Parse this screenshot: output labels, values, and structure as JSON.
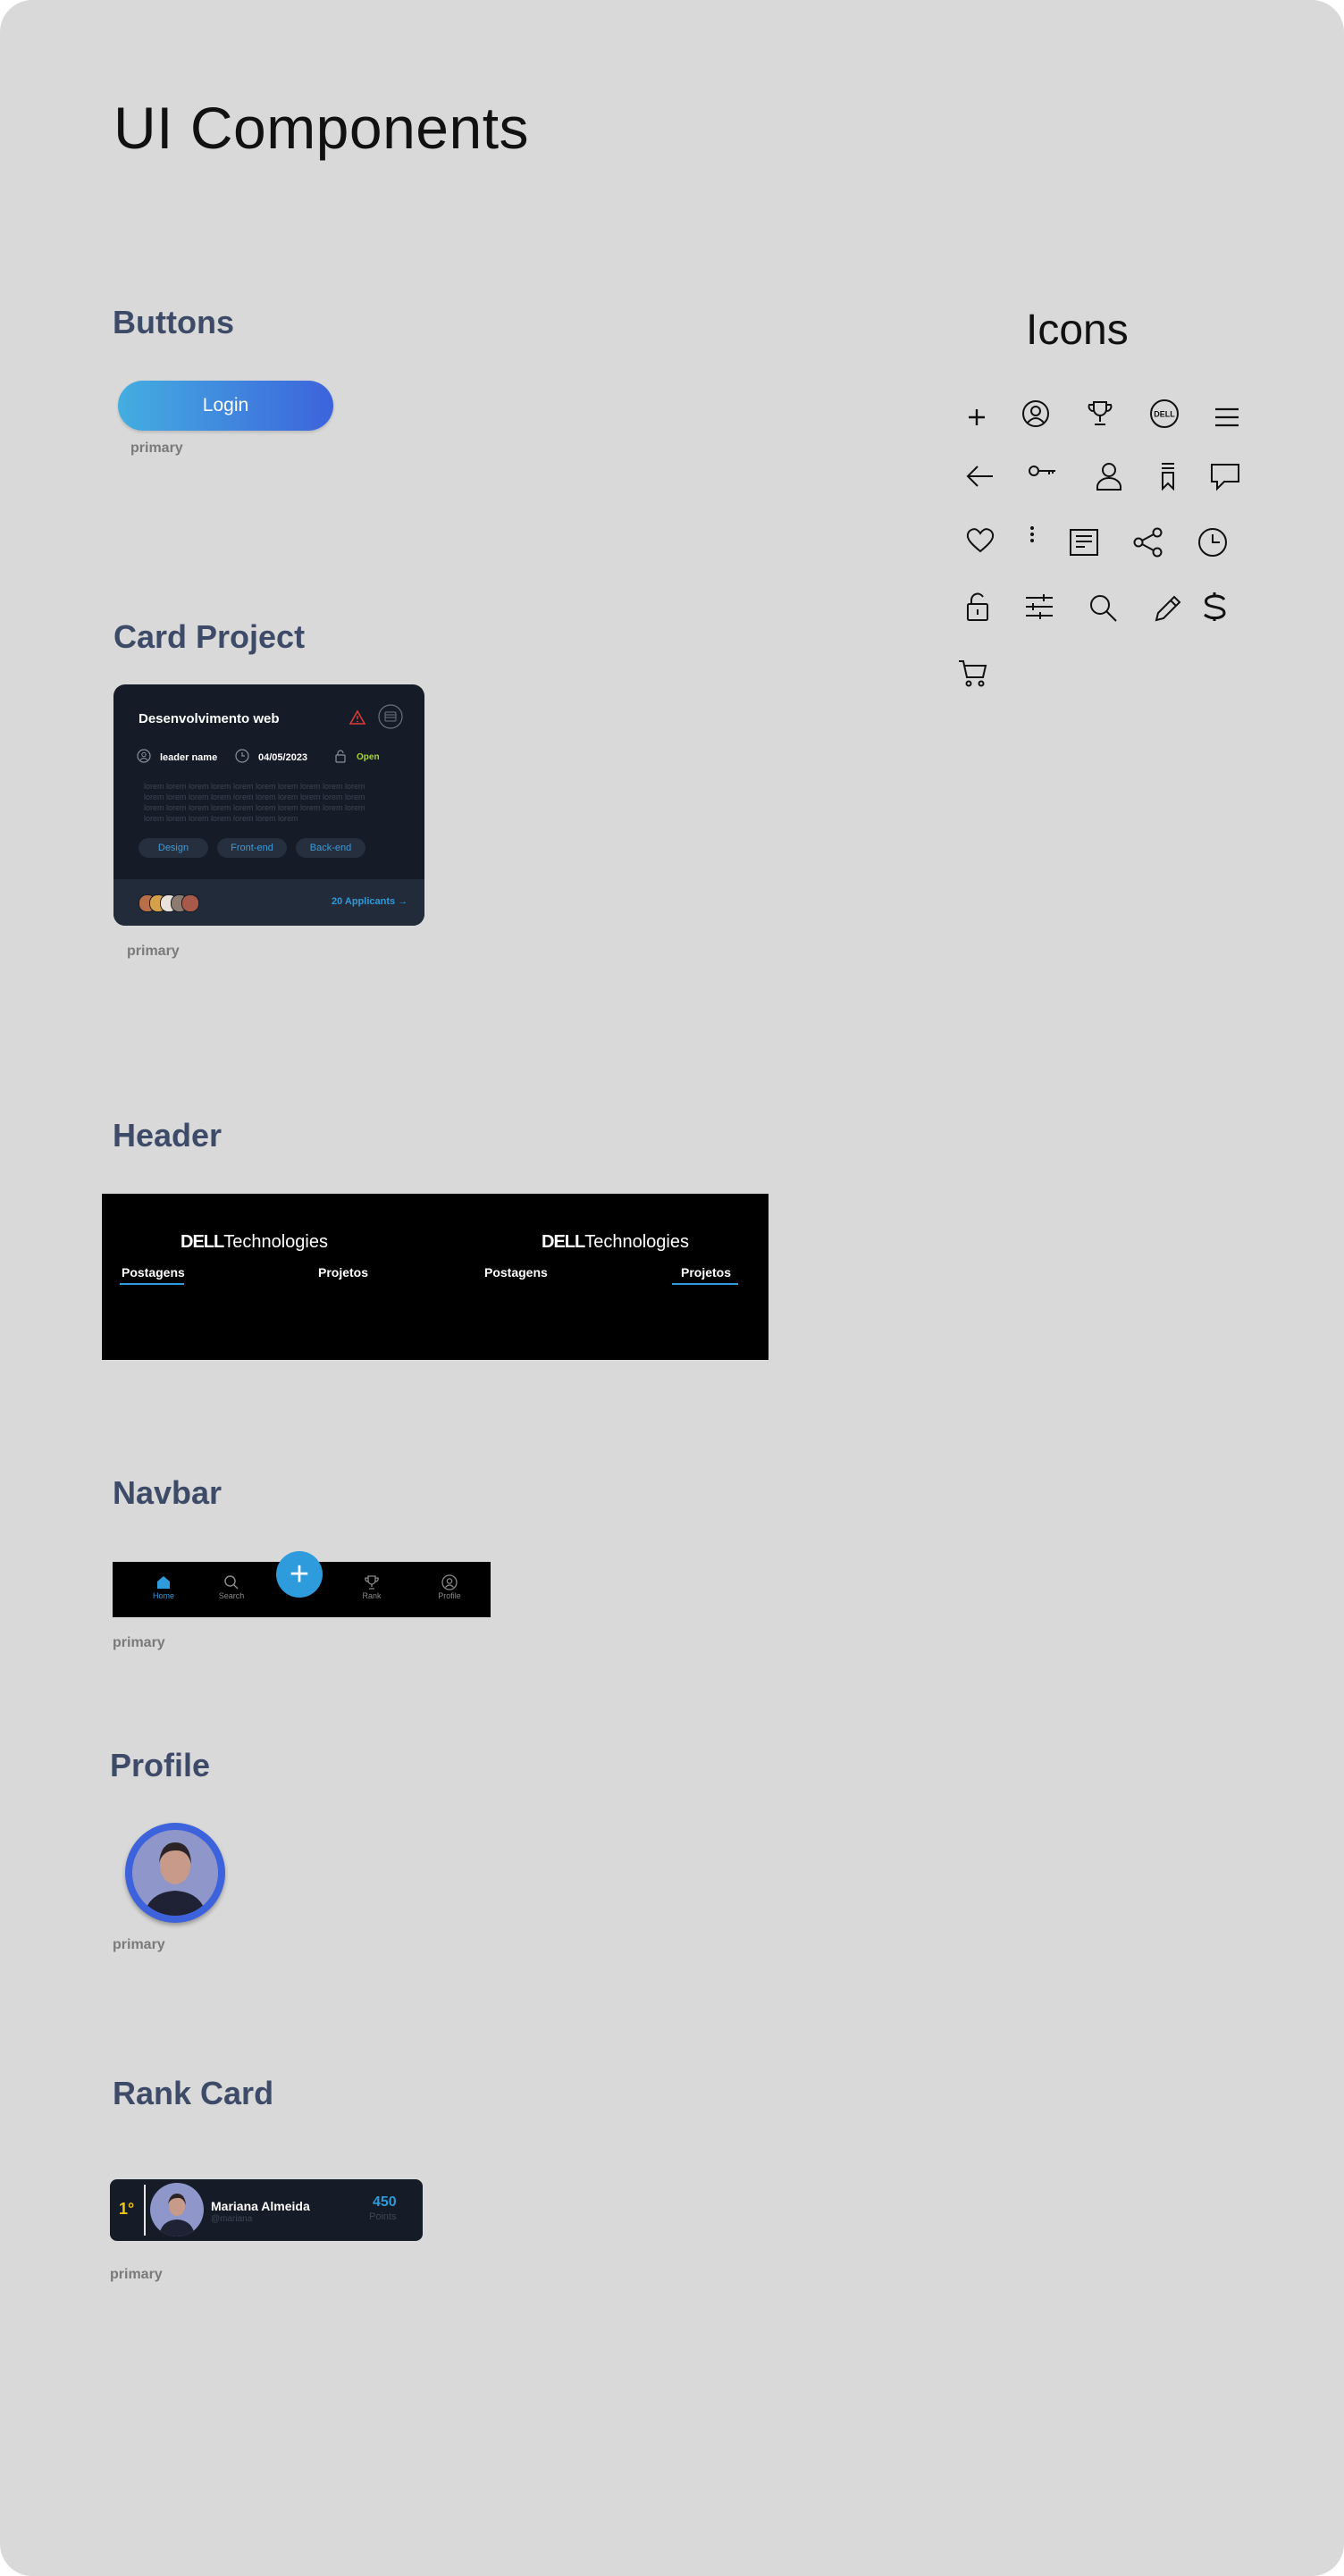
{
  "page_title": "UI Components",
  "sections": {
    "buttons": "Buttons",
    "card_project": "Card Project",
    "header": "Header",
    "navbar": "Navbar",
    "profile": "Profile",
    "rank_card": "Rank Card",
    "icons": "Icons"
  },
  "caption": "primary",
  "login_button": {
    "label": "Login"
  },
  "card": {
    "title": "Desenvolvimento web",
    "leader": "leader name",
    "date": "04/05/2023",
    "status": "Open",
    "description": "lorem lorem lorem lorem lorem lorem lorem lorem lorem lorem lorem lorem lorem lorem lorem lorem lorem lorem lorem lorem lorem lorem lorem lorem lorem lorem lorem lorem lorem lorem lorem lorem lorem lorem lorem lorem lorem",
    "tags": [
      "Design",
      "Front-end",
      "Back-end"
    ],
    "applicants": "20 Applicants",
    "colors": {
      "bg": "#151c27",
      "accent": "#2f9ad9",
      "status": "#a8d62a",
      "alert": "#e03b3b"
    }
  },
  "header": {
    "logo_brand": "DELL",
    "logo_suffix": "Technologies",
    "tabs": [
      "Postagens",
      "Projetos"
    ],
    "variant_a_active": "Postagens",
    "variant_b_active": "Projetos"
  },
  "navbar": {
    "items": [
      "Home",
      "Search",
      "Rank",
      "Profile"
    ],
    "active": "Home",
    "fab": "+"
  },
  "rank_card": {
    "position": "1°",
    "name": "Mariana Almeida",
    "handle": "@mariana",
    "points": "450",
    "points_label": "Points"
  },
  "icons": [
    "plus-icon",
    "user-circle-icon",
    "trophy-icon",
    "dell-logo-icon",
    "menu-icon",
    "arrow-left-icon",
    "key-icon",
    "user-icon",
    "bookmark-icon",
    "comment-icon",
    "heart-icon",
    "more-vertical-icon",
    "document-icon",
    "share-icon",
    "clock-icon",
    "unlock-icon",
    "sliders-icon",
    "search-icon",
    "pencil-icon",
    "dollar-icon",
    "cart-icon"
  ]
}
